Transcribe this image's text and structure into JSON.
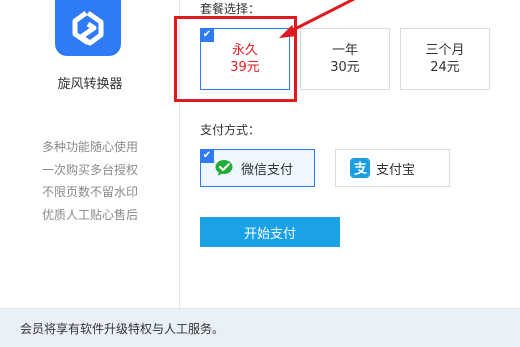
{
  "app": {
    "name": "旋风转换器",
    "features": [
      "多种功能随心使用",
      "一次购买多台授权",
      "不限页数不留水印",
      "优质人工贴心售后"
    ]
  },
  "package": {
    "label": "套餐选择：",
    "plans": [
      {
        "name": "永久",
        "price": "39元",
        "selected": true
      },
      {
        "name": "一年",
        "price": "30元",
        "selected": false
      },
      {
        "name": "三个月",
        "price": "24元",
        "selected": false
      }
    ]
  },
  "payment": {
    "label": "支付方式：",
    "methods": [
      {
        "name": "微信支付",
        "icon": "wechat-pay-icon",
        "selected": true
      },
      {
        "name": "支付宝",
        "icon": "alipay-icon",
        "selected": false
      }
    ],
    "start_button": "开始支付"
  },
  "footer": {
    "text": "会员将享有软件升级特权与人工服务。"
  },
  "colors": {
    "accent": "#2f7bf5",
    "highlight": "#e0191f",
    "button": "#1aa1e6",
    "price_selected": "#e02020"
  }
}
